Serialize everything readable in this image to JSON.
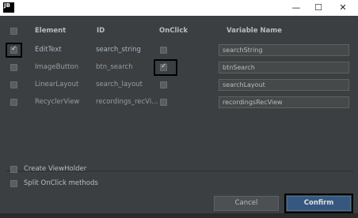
{
  "titlebar": {
    "app_icon": "JB",
    "minimize": "—",
    "maximize": "☐",
    "close": "✕"
  },
  "table": {
    "headers": {
      "element": "Element",
      "id": "ID",
      "onclick": "OnClick",
      "variable": "Variable Name"
    },
    "rows": [
      {
        "element": "EditText",
        "id": "search_string",
        "selected": true,
        "onclick": false,
        "variable": "searchString"
      },
      {
        "element": "ImageButton",
        "id": "btn_search",
        "selected": false,
        "onclick": true,
        "variable": "btnSearch"
      },
      {
        "element": "LinearLayout",
        "id": "search_layout",
        "selected": false,
        "onclick": false,
        "variable": "searchLayout"
      },
      {
        "element": "RecyclerView",
        "id": "recordings_recVi...",
        "selected": false,
        "onclick": false,
        "variable": "recordingsRecView"
      }
    ]
  },
  "options": {
    "create_viewholder": "Create ViewHolder",
    "split_onclick": "Split OnClick methods"
  },
  "buttons": {
    "cancel": "Cancel",
    "confirm": "Confirm"
  }
}
